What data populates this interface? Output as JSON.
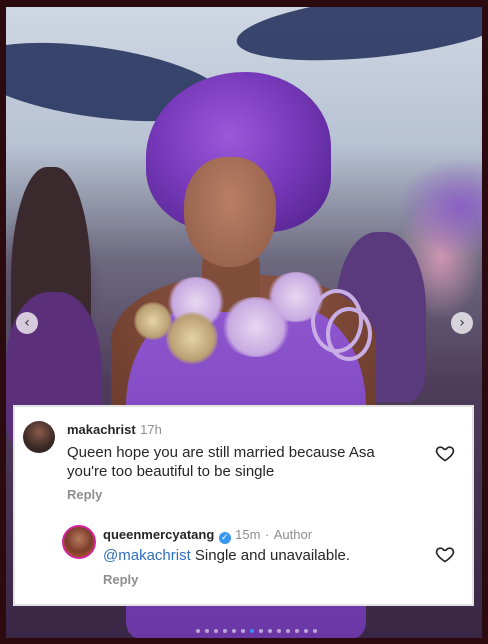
{
  "comment": {
    "username": "makachrist",
    "time": "17h",
    "text": "Queen hope you are still married because Asa you're too beautiful to be single",
    "reply_label": "Reply",
    "like_icon": "heart-outline-icon"
  },
  "reply": {
    "username": "queenmercyatang",
    "verified_icon": "verified-badge-icon",
    "time": "15m",
    "separator": "·",
    "role": "Author",
    "mention": "@makachrist",
    "text": "Single and unavailable.",
    "reply_label": "Reply",
    "like_icon": "heart-outline-icon"
  },
  "carousel": {
    "prev_icon": "chevron-left-icon",
    "next_icon": "chevron-right-icon",
    "page_count": 14,
    "active_index": 6
  },
  "colors": {
    "frame": "#2b0a10",
    "mention": "#2f6ebd",
    "verified": "#3897f0",
    "dress": "#7c45bd"
  }
}
